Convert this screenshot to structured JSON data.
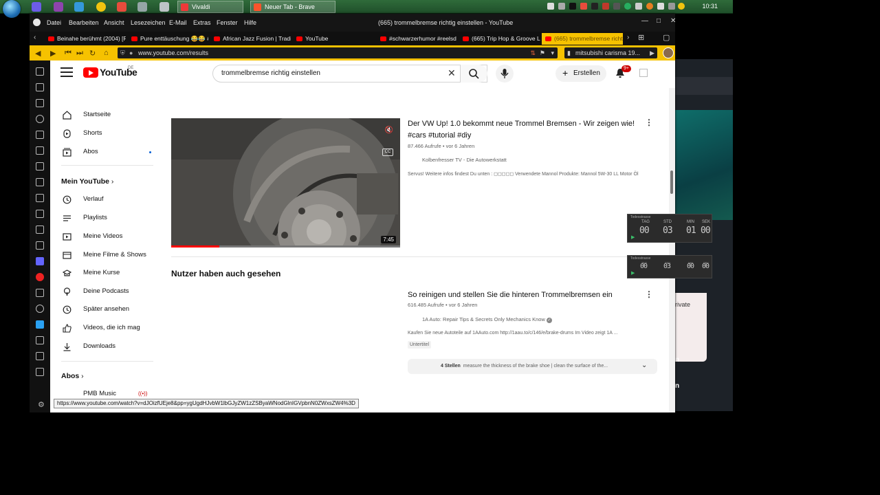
{
  "taskbar": {
    "tasks": [
      {
        "label": "Vivaldi"
      },
      {
        "label": "Neuer Tab - Brave"
      }
    ],
    "clock": "10:31"
  },
  "browser": {
    "menus": [
      "Datei",
      "Bearbeiten",
      "Ansicht",
      "Lesezeichen",
      "E-Mail",
      "Extras",
      "Fenster",
      "Hilfe"
    ],
    "window_title": "(665) trommelbremse richtig einstellen - YouTube",
    "tabs": [
      {
        "label": "Beinahe berühmt (2004) [R"
      },
      {
        "label": "Pure enttäuschung 😂😂 #s"
      },
      {
        "label": "African Jazz Fusion | Traditi"
      },
      {
        "label": "YouTube"
      },
      {
        "label": "#schwarzerhumor #reelsde"
      },
      {
        "label": "(665) Trip Hop & Groove Lo"
      },
      {
        "label": "(665) trommelbremse richti"
      }
    ],
    "url": "www.youtube.com/results",
    "bookmark_search": "mitsubishi carisma 19...",
    "status_url": "https://www.youtube.com/watch?v=dJOizfUEje8&pp=ygUgdHJvbW1lbGJyZW1zZSByaWNodGlnIGVpbnN0ZWxsZW4%3D"
  },
  "yt": {
    "logo_text": "YouTube",
    "logo_region": "DE",
    "search_value": "trommelbremse richtig einstellen",
    "create_label": "Erstellen",
    "notif_count": "9+",
    "sidebar": {
      "top": [
        {
          "label": "Startseite",
          "icon": "home-icon"
        },
        {
          "label": "Shorts",
          "icon": "shorts-icon"
        },
        {
          "label": "Abos",
          "icon": "subscriptions-icon"
        }
      ],
      "you_header": "Mein YouTube",
      "you": [
        {
          "label": "Verlauf",
          "icon": "history-icon"
        },
        {
          "label": "Playlists",
          "icon": "playlists-icon"
        },
        {
          "label": "Meine Videos",
          "icon": "my-videos-icon"
        },
        {
          "label": "Meine Filme & Shows",
          "icon": "movies-icon"
        },
        {
          "label": "Meine Kurse",
          "icon": "courses-icon"
        },
        {
          "label": "Deine Podcasts",
          "icon": "podcasts-icon"
        },
        {
          "label": "Später ansehen",
          "icon": "watch-later-icon"
        },
        {
          "label": "Videos, die ich mag",
          "icon": "like-icon"
        },
        {
          "label": "Downloads",
          "icon": "download-icon"
        }
      ],
      "subs_header": "Abos",
      "subs": [
        {
          "label": "PMB Music"
        }
      ]
    },
    "result1": {
      "title": "Der VW Up! 1.0 bekommt neue Trommel Bremsen - Wir zeigen wie! #cars #tutorial #diy",
      "meta": "87.466 Aufrufe • vor 6 Jahren",
      "channel": "Kolbenfresser TV - Die Autowerkstatt",
      "desc": "Servus! Weitere infos findest Du unten : ◻◻◻◻◻ Verwendete Mannol Produkte: Mannol 5W-30 LL Motor Öl",
      "duration": "7:45",
      "progress_fraction": 0.21,
      "cc": "CC"
    },
    "shelf_title": "Nutzer haben auch gesehen",
    "result2": {
      "title": "So reinigen und stellen Sie die hinteren Trommelbremsen ein",
      "meta": "616.485 Aufrufe • vor 6 Jahren",
      "channel": "1A Auto: Repair Tips & Secrets Only Mechanics Know",
      "desc": "Kaufen Sie neue Autoteile auf 1AAuto.com http://1aau.to/c/146/e/brake-drums Im Video zeigt 1A ...",
      "badge": "Untertitel",
      "chapters_count": "4 Stellen",
      "chapters_text": "measure the thickness of the brake shoe | clean the surface of the..."
    }
  },
  "rightapp": {
    "private_label": "rivate",
    "n1": "n",
    "n2": "n"
  },
  "timers": [
    {
      "head": "Todesstrasse",
      "labels": [
        "TAG",
        "STD",
        "MIN",
        "SEK"
      ],
      "values": [
        "00",
        "03",
        "01",
        "00"
      ]
    },
    {
      "head": "Todesstrasse",
      "labels": [
        "TAG",
        "STD",
        "MIN",
        "SEK"
      ],
      "values": [
        "00",
        "03",
        "00",
        "00"
      ]
    }
  ],
  "colors": {
    "vivaldi_accent": "#f6c200",
    "yt_red": "#ff0000"
  }
}
